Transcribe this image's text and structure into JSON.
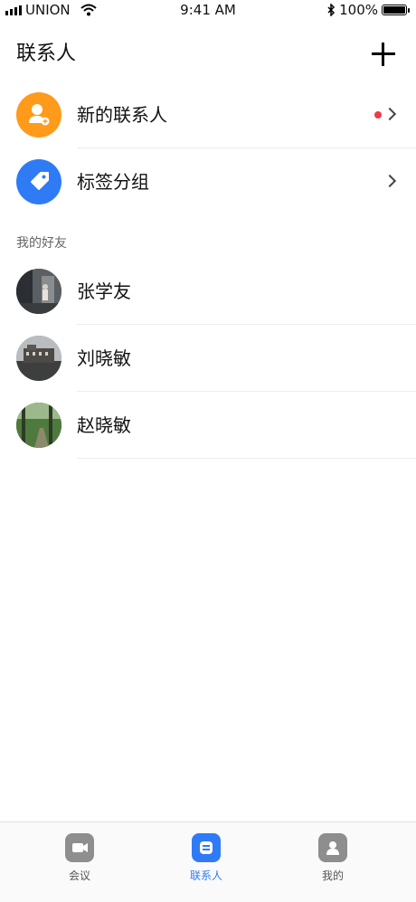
{
  "status_bar": {
    "carrier": "UNION",
    "time": "9:41 AM",
    "battery": "100%"
  },
  "header": {
    "title": "联系人"
  },
  "top_items": [
    {
      "label": "新的联系人",
      "color": "#ff9a1a",
      "icon": "add-contact-icon",
      "has_badge": true
    },
    {
      "label": "标签分组",
      "color": "#2f7bf5",
      "icon": "tag-icon",
      "has_badge": false
    }
  ],
  "section": {
    "title": "我的好友"
  },
  "friends": [
    {
      "name": "张学友"
    },
    {
      "name": "刘晓敏"
    },
    {
      "name": "赵晓敏"
    }
  ],
  "tabs": [
    {
      "label": "会议",
      "icon": "video-icon",
      "active": false
    },
    {
      "label": "联系人",
      "icon": "contacts-icon",
      "active": true
    },
    {
      "label": "我的",
      "icon": "profile-icon",
      "active": false
    }
  ],
  "colors": {
    "accent": "#2f7bf5",
    "badge": "#ee3a4a"
  }
}
